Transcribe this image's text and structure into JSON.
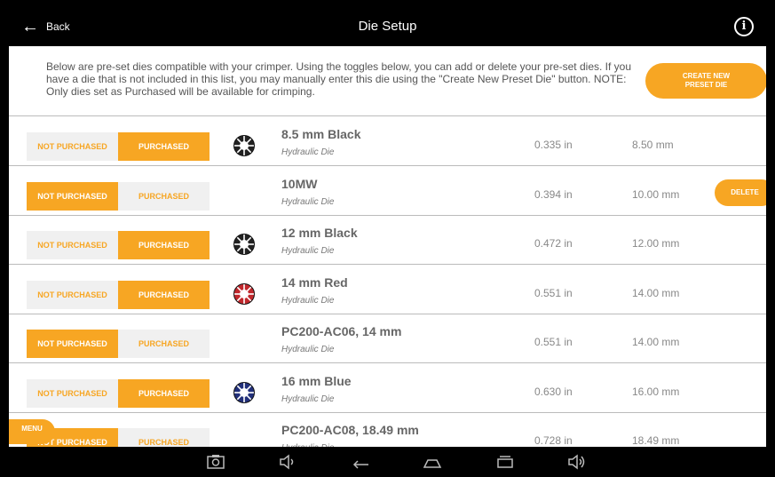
{
  "topbar": {
    "back_label": "Back",
    "title": "Die Setup",
    "info_glyph": "i"
  },
  "intro": {
    "text": "Below are pre-set dies compatible with your crimper. Using the toggles below, you can add or delete your pre-set dies. If you have a die that is not included in this list, you may manually enter this die using the \"Create New Preset Die\" button. NOTE: Only dies set as Purchased will be available for crimping.",
    "create_button_line1": "CREATE NEW",
    "create_button_line2": "PRESET DIE"
  },
  "toggle_labels": {
    "not_purchased": "NOT PURCHASED",
    "purchased": "PURCHASED"
  },
  "dies": [
    {
      "name": "8.5 mm Black",
      "type": "Hydraulic Die",
      "inches": "0.335 in",
      "mm": "8.50 mm",
      "state": "purchased",
      "color": "#222222",
      "icon": "die-black-icon",
      "delete": null
    },
    {
      "name": "10MW",
      "type": "Hydraulic Die",
      "inches": "0.394 in",
      "mm": "10.00 mm",
      "state": "not_purchased",
      "color": null,
      "icon": null,
      "delete": "DELETE"
    },
    {
      "name": "12 mm Black",
      "type": "Hydraulic Die",
      "inches": "0.472 in",
      "mm": "12.00 mm",
      "state": "purchased",
      "color": "#222222",
      "icon": "die-black-icon",
      "delete": null
    },
    {
      "name": "14 mm Red",
      "type": "Hydraulic Die",
      "inches": "0.551 in",
      "mm": "14.00 mm",
      "state": "purchased",
      "color": "#c0282d",
      "icon": "die-red-icon",
      "delete": null
    },
    {
      "name": "PC200-AC06, 14 mm",
      "type": "Hydraulic Die",
      "inches": "0.551 in",
      "mm": "14.00 mm",
      "state": "not_purchased",
      "color": null,
      "icon": null,
      "delete": null
    },
    {
      "name": "16 mm Blue",
      "type": "Hydraulic Die",
      "inches": "0.630 in",
      "mm": "16.00 mm",
      "state": "purchased",
      "color": "#22307a",
      "icon": "die-blue-icon",
      "delete": null
    },
    {
      "name": "PC200-AC08, 18.49 mm",
      "type": "Hydraulic Die",
      "inches": "0.728 in",
      "mm": "18.49 mm",
      "state": "not_purchased",
      "color": null,
      "icon": null,
      "delete": null
    }
  ],
  "menu_label": "MENU",
  "accent_color": "#f7a623",
  "navbar": {
    "icons": [
      "screenshot-icon",
      "volume-down-icon",
      "back-nav-icon",
      "home-icon",
      "recents-icon",
      "volume-up-icon"
    ]
  }
}
